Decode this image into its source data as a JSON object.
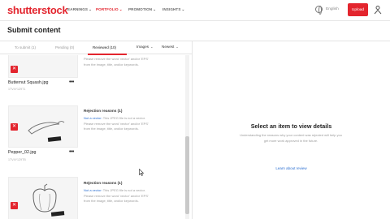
{
  "brand": {
    "logo": "shutterstock",
    "accent": "#e3252e",
    "link_color": "#2b6fd1"
  },
  "nav": {
    "items": [
      {
        "label": "EARNINGS",
        "active": false
      },
      {
        "label": "PORTFOLIO",
        "active": true
      },
      {
        "label": "PROMOTION",
        "active": false
      },
      {
        "label": "INSIGHTS",
        "active": false
      }
    ],
    "chevron": "⌄",
    "language": "English",
    "upload_label": "Upload",
    "account_icon": "account-icon"
  },
  "page": {
    "title": "Submit content"
  },
  "tabs": [
    {
      "label": "To submit (1)",
      "active": false
    },
    {
      "label": "Pending (0)",
      "active": false
    },
    {
      "label": "Reviewed (10)",
      "active": true
    }
  ],
  "filters": {
    "type": "Images",
    "sort": "Newest",
    "chevron": "⌄"
  },
  "items": [
    {
      "file_name": "Butternut Squash.jpg",
      "file_id": "1TV4Y1Z9T1",
      "reason_title": "",
      "reason_highlight": "",
      "reason_rest": "",
      "reason_line2": "Please remove the word 'vector' and/or 'EPS'",
      "reason_line3": "from the image, title, and/or keywords."
    },
    {
      "file_name": "Pepper_02.jpg",
      "file_id": "1TV4Y1Z9TB",
      "reason_title": "Rejection reasons (1)",
      "reason_highlight": "Not a vector:",
      "reason_rest": " This JPEG file is not a vector.",
      "reason_line2": "Please remove the word 'vector' and/or 'EPS'",
      "reason_line3": "from the image, title, and/or keywords."
    },
    {
      "file_name": "",
      "file_id": "",
      "reason_title": "Rejection reasons (1)",
      "reason_highlight": "Not a vector:",
      "reason_rest": " This JPEG file is not a vector.",
      "reason_line2": "Please remove the word 'vector' and/or 'EPS'",
      "reason_line3": "from the image, title, and/or keywords."
    }
  ],
  "remove_icon": "✕",
  "more_icon": "•••",
  "detail": {
    "title": "Select an item to view details",
    "body": "Understanding the reasons why your content was rejected will help you get more work approved in the future.",
    "link": "Learn about review"
  }
}
